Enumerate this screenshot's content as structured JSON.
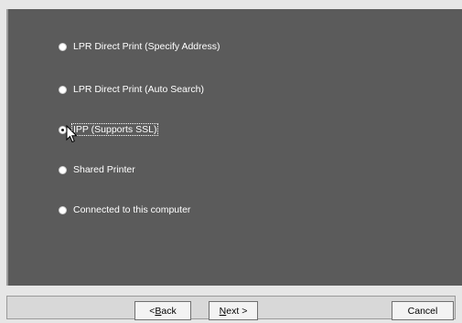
{
  "options": [
    {
      "label": "LPR Direct Print (Specify Address)",
      "checked": false
    },
    {
      "label": "LPR Direct Print (Auto Search)",
      "checked": false
    },
    {
      "label": "IPP (Supports SSL)",
      "checked": true
    },
    {
      "label": "Shared Printer",
      "checked": false
    },
    {
      "label": "Connected to this computer",
      "checked": false
    }
  ],
  "buttons": {
    "back_prefix": "< ",
    "back_key": "B",
    "back_rest": "ack",
    "next_key": "N",
    "next_rest": "ext >",
    "cancel": "Cancel"
  }
}
